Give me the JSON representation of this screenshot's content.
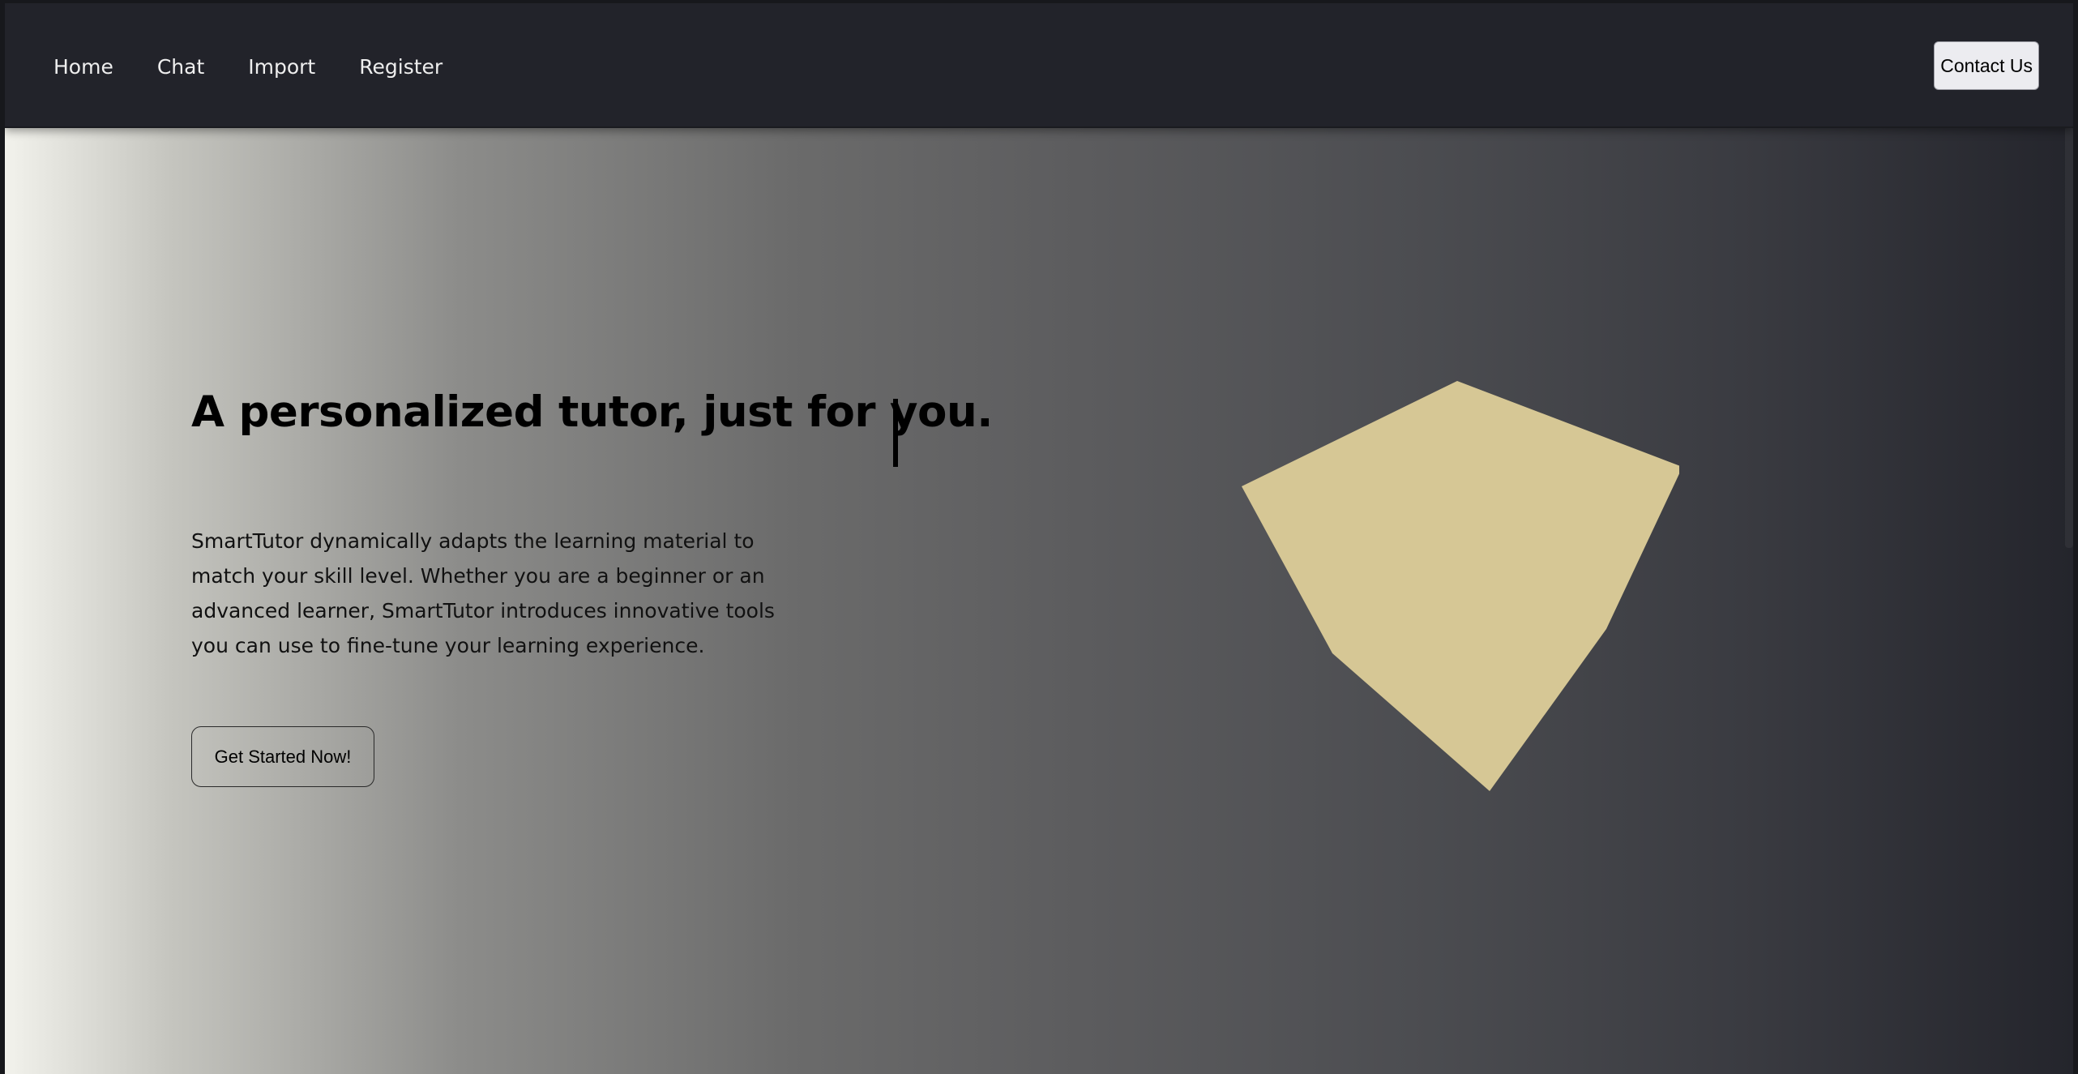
{
  "nav": {
    "items": [
      {
        "label": "Home"
      },
      {
        "label": "Chat"
      },
      {
        "label": "Import"
      },
      {
        "label": "Register"
      }
    ],
    "contact_label": "Contact Us"
  },
  "hero": {
    "title": "A personalized tutor, just for you.",
    "description": "SmartTutor dynamically adapts the learning material to match your skill level. Whether you are a beginner or an advanced learner, SmartTutor introduces innovative tools you can use to fine-tune your learning experience.",
    "cta_label": "Get Started Now!"
  },
  "colors": {
    "navbar_bg": "#22232a",
    "shape_fill": "#d6c795",
    "gradient_left": "#f2f2ec",
    "gradient_right": "#24252c"
  },
  "icons": {
    "typing_cursor": "text-cursor-bar",
    "hero_shape": "polygon-shape"
  }
}
